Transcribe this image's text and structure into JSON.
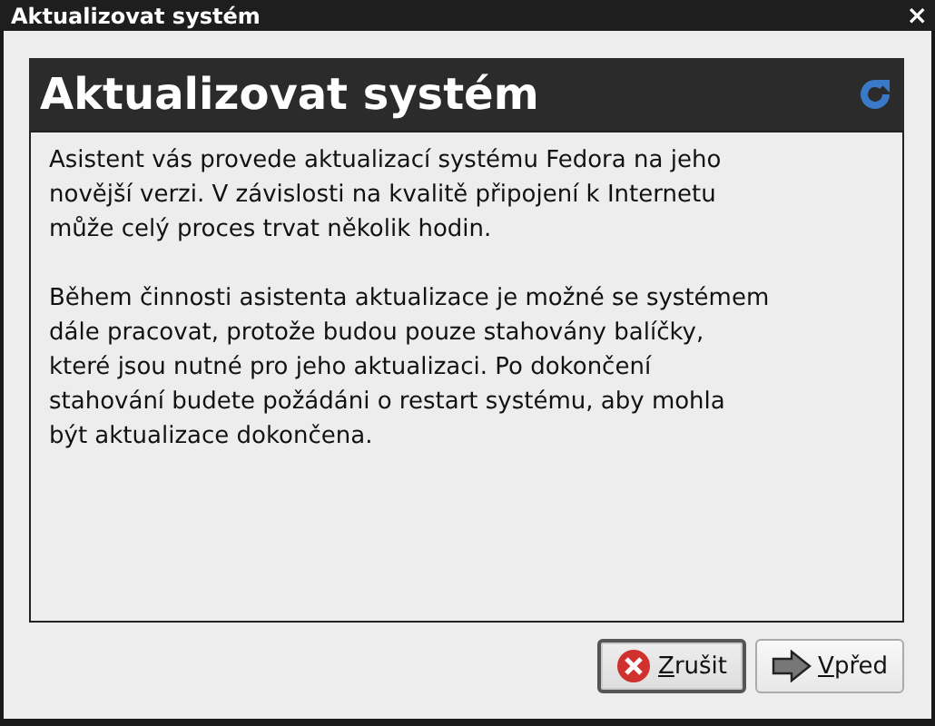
{
  "window": {
    "title": "Aktualizovat systém",
    "close": "×"
  },
  "header": {
    "title": "Aktualizovat systém"
  },
  "paragraphs": [
    "Asistent vás provede aktualizací systému Fedora na jeho novější verzi. V závislosti na kvalitě připojení k Internetu může celý proces trvat několik hodin.",
    "Během činnosti asistenta aktualizace je možné se systémem dále pracovat, protože budou pouze stahovány balíčky, které jsou nutné pro jeho aktualizaci. Po dokončení stahování budete požádáni o restart systému, aby mohla být aktualizace dokončena."
  ],
  "buttons": [
    {
      "label": "Zrušit",
      "kind": "cancel",
      "focused": true,
      "mnemonic_first": true
    },
    {
      "label": "Vpřed",
      "kind": "forward",
      "focused": false,
      "mnemonic_first": true
    }
  ]
}
